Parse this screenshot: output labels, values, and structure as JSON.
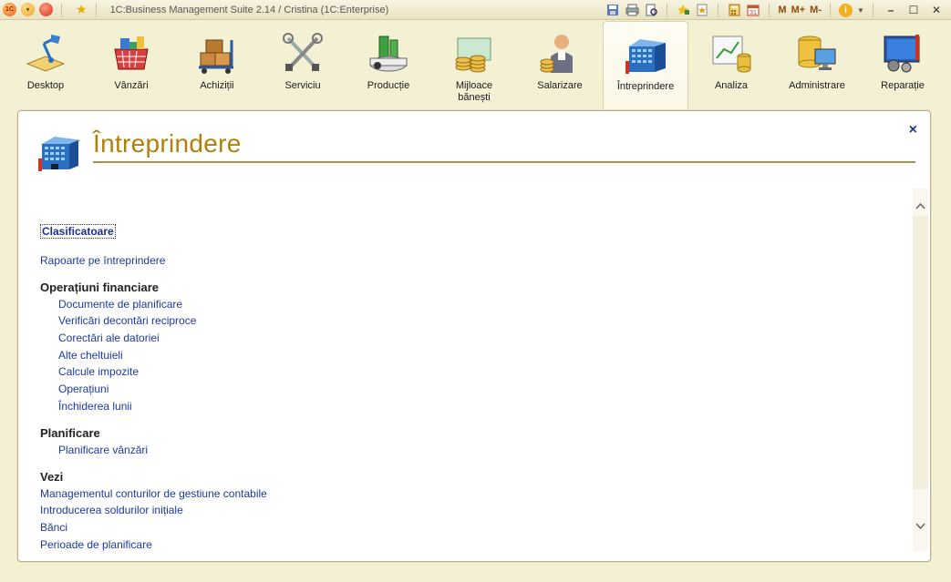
{
  "window": {
    "title": "1C:Business Management Suite 2.14 / Cristina  (1C:Enterprise)",
    "toolbar_right": {
      "m": "M",
      "m_plus": "M+",
      "m_minus": "M-"
    }
  },
  "sections": [
    {
      "label": "Desktop",
      "icon": "desktop-lamp-icon"
    },
    {
      "label": "Vânzări",
      "icon": "shopping-basket-icon"
    },
    {
      "label": "Achiziții",
      "icon": "boxes-cart-icon"
    },
    {
      "label": "Serviciu",
      "icon": "tools-icon"
    },
    {
      "label": "Producție",
      "icon": "factory-icon"
    },
    {
      "label": "Mijloace bănești",
      "icon": "coins-icon"
    },
    {
      "label": "Salarizare",
      "icon": "worker-coins-icon"
    },
    {
      "label": "Întreprindere",
      "icon": "building-icon",
      "active": true
    },
    {
      "label": "Analiza",
      "icon": "chart-db-icon"
    },
    {
      "label": "Administrare",
      "icon": "db-monitor-icon"
    },
    {
      "label": "Reparație",
      "icon": "monitor-gears-icon"
    }
  ],
  "panel": {
    "title": "Întreprindere",
    "close": "×",
    "links": {
      "classifiers": "Clasificatoare",
      "reports": "Rapoarte pe întreprindere"
    },
    "groups": {
      "financial": {
        "title": "Operațiuni financiare",
        "items": [
          "Documente de planificare",
          "Verificări decontări reciproce",
          "Corectări ale datoriei",
          "Alte cheltuieli",
          "Calcule impozite",
          "Operațiuni",
          "Închiderea lunii"
        ]
      },
      "planning": {
        "title": "Planificare",
        "items": [
          "Planificare vânzări"
        ]
      },
      "see": {
        "title": "Vezi",
        "items": [
          "Managementul conturilor de gestiune contabile",
          "Introducerea soldurilor inițiale",
          "Bănci",
          "Perioade de planificare"
        ]
      }
    }
  }
}
